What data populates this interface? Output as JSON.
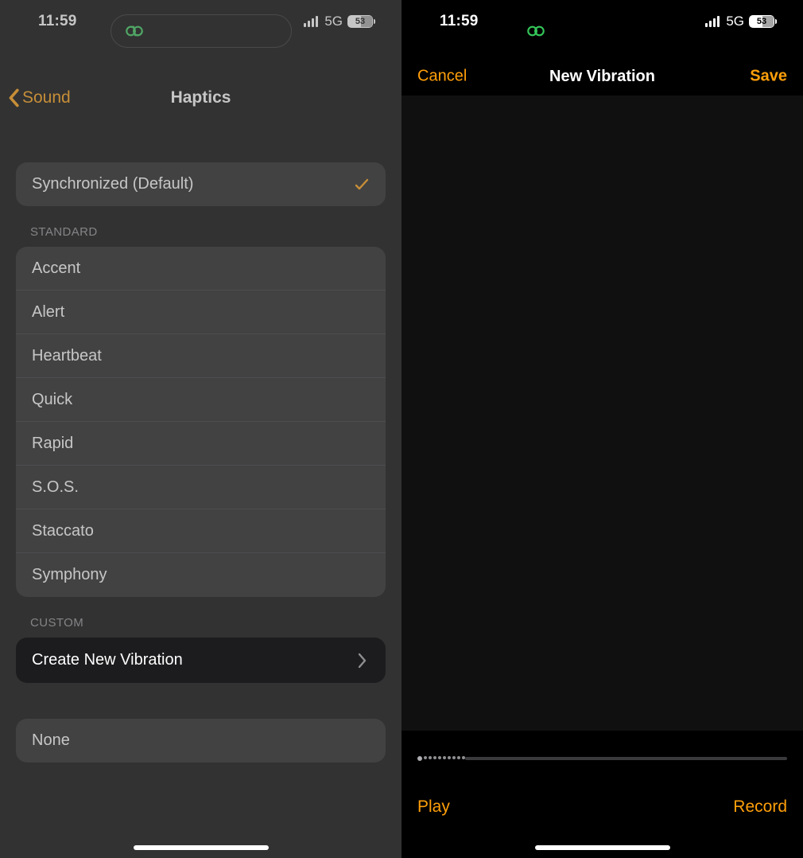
{
  "status": {
    "time": "11:59",
    "network": "5G",
    "battery_pct": "53"
  },
  "left": {
    "back_label": "Sound",
    "title": "Haptics",
    "default_row": "Synchronized (Default)",
    "sections": {
      "standard_title": "STANDARD",
      "standard": [
        "Accent",
        "Alert",
        "Heartbeat",
        "Quick",
        "Rapid",
        "S.O.S.",
        "Staccato",
        "Symphony"
      ],
      "custom_title": "CUSTOM",
      "create_label": "Create New Vibration",
      "none_label": "None"
    }
  },
  "right": {
    "cancel": "Cancel",
    "title": "New Vibration",
    "save": "Save",
    "play": "Play",
    "record": "Record"
  }
}
